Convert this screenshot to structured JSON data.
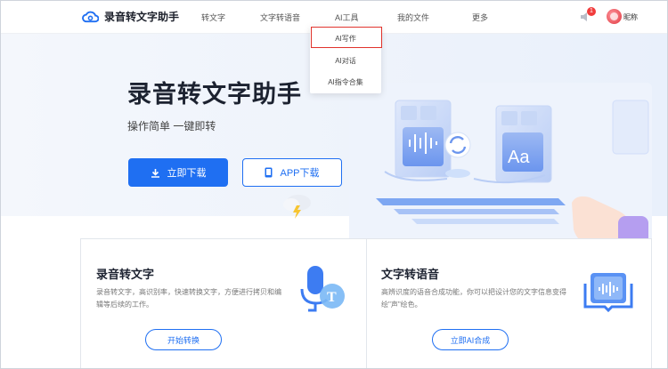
{
  "app": {
    "logo_text": "录音转文字助手"
  },
  "nav": {
    "items": [
      {
        "label": "转文字"
      },
      {
        "label": "文字转语音"
      },
      {
        "label": "AI工具"
      },
      {
        "label": "我的文件"
      },
      {
        "label": "更多"
      }
    ],
    "notification_count": "1",
    "username": "昵称"
  },
  "dropdown": {
    "items": [
      {
        "label": "AI写作"
      },
      {
        "label": "AI对话"
      },
      {
        "label": "AI指令合集"
      }
    ]
  },
  "hero": {
    "title": "录音转文字助手",
    "subtitle": "操作简单 一键即转",
    "download_label": "立即下载",
    "app_download_label": "APP下载"
  },
  "cards": [
    {
      "title": "录音转文字",
      "desc": "录音转文字，高识别率，快速转换文字，方便进行拷贝和编辑等后续的工作。",
      "button": "开始转换"
    },
    {
      "title": "文字转语音",
      "desc": "高辨识度的语音合成功能，你可以把设计您的文字信息变得绘\"声\"绘色。",
      "button": "立即AI合成"
    }
  ],
  "colors": {
    "primary": "#1f6ff2",
    "highlight_border": "#e0322b",
    "badge": "#f13c3c"
  }
}
